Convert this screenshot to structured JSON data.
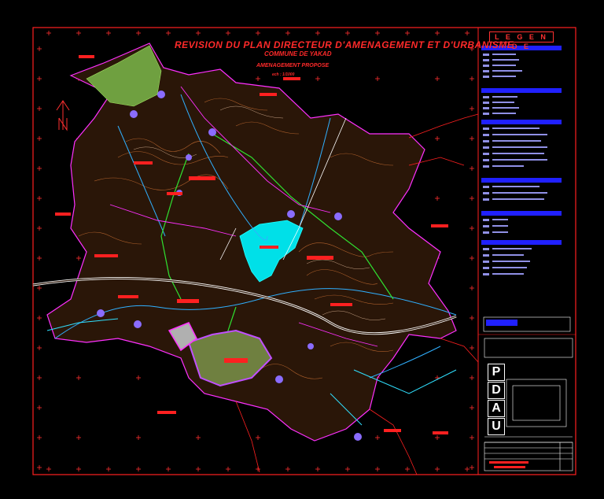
{
  "map": {
    "title": "REVISION DU PLAN DIRECTEUR D'AMENAGEMENT ET D'URBANISME",
    "subtitle": "COMMUNE DE YAKAD",
    "subtitle2": "AMENAGEMENT PROPOSE",
    "scale": "ech : 1/1000",
    "north": "N"
  },
  "legend": {
    "heading": "L E G E N D E"
  },
  "cartouche": {
    "letters": [
      "P",
      "D",
      "A",
      "U"
    ]
  },
  "colors": {
    "border": "#ff2020",
    "contours_dark": "#b05a20",
    "contours_light": "#e8b890",
    "water": "#00e0e8",
    "roads_main": "#ffffff",
    "roads_green": "#30e030",
    "rivers": "#30b0ff",
    "lines_magenta": "#ff30ff",
    "forest": "#6fa040",
    "labels": "#ff2020",
    "legend_bars": "#3030ff"
  }
}
